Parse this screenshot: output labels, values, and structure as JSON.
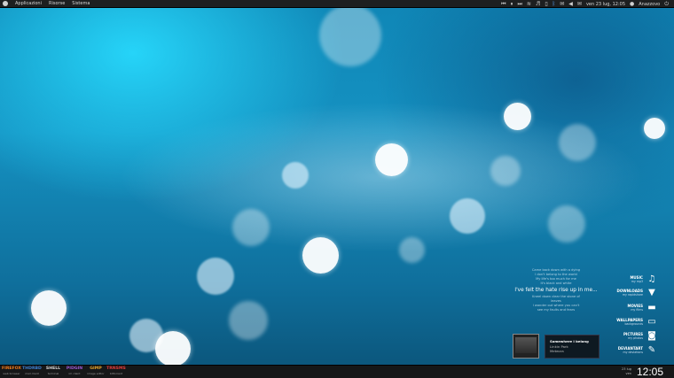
{
  "top_panel": {
    "menus": [
      "Applicazioni",
      "Risorse",
      "Sistema"
    ],
    "clock": "ven 23 lug, 12:05",
    "user": "Anazzovo",
    "tray_icons": [
      "prev-icon",
      "pause-icon",
      "next-icon",
      "wifi-icon",
      "headphones-icon",
      "battery-icon",
      "bluetooth-icon",
      "chat-icon",
      "volume-icon",
      "mail-icon",
      "power-icon"
    ]
  },
  "lyrics": {
    "lines_before": [
      "Came back down with a dying",
      "I don't belong to the world",
      "My life's too much for me",
      "It's black and white"
    ],
    "main_line": "I've felt the hate rise up in me...",
    "lines_after": [
      "Kneel down clear the stone of",
      "leaves",
      "I wander out where you can't",
      "see my faults and fears"
    ]
  },
  "places": [
    {
      "title": "MUSIC",
      "sub": "my mp3",
      "icon": "music-icon",
      "glyph": "♫"
    },
    {
      "title": "DOWNLOADS",
      "sub": "my rapidshare",
      "icon": "download-icon",
      "glyph": "▼"
    },
    {
      "title": "MOVIES",
      "sub": "my films",
      "icon": "clapper-icon",
      "glyph": "▬"
    },
    {
      "title": "WALLPAPERS",
      "sub": "backgrounds",
      "icon": "wallpaper-icon",
      "glyph": "▭"
    },
    {
      "title": "PICTURES",
      "sub": "my photos",
      "icon": "camera-icon",
      "glyph": "◙"
    },
    {
      "title": "DEVIANTART",
      "sub": "my deviations",
      "icon": "pen-icon",
      "glyph": "✎"
    }
  ],
  "now_playing": {
    "track": "Somewhere I belong",
    "artist": "Linkin Park",
    "album": "Meteora"
  },
  "launchers": [
    {
      "name": "FIREFOX",
      "sub": "web browser",
      "color": "#f07a1a"
    },
    {
      "name": "THDRBD",
      "sub": "mail client",
      "color": "#3b7fd0"
    },
    {
      "name": "SHELL",
      "sub": "terminal",
      "color": "#d8d8d8"
    },
    {
      "name": "PIDGIN",
      "sub": "im client",
      "color": "#9b59d0"
    },
    {
      "name": "GIMP",
      "sub": "image editor",
      "color": "#e0a02a"
    },
    {
      "name": "TRNSMS",
      "sub": "bittorrent",
      "color": "#e03a3a"
    }
  ],
  "bottom_clock": {
    "time": "12:05",
    "date_line1": "23 lug",
    "date_line2": "ven"
  }
}
